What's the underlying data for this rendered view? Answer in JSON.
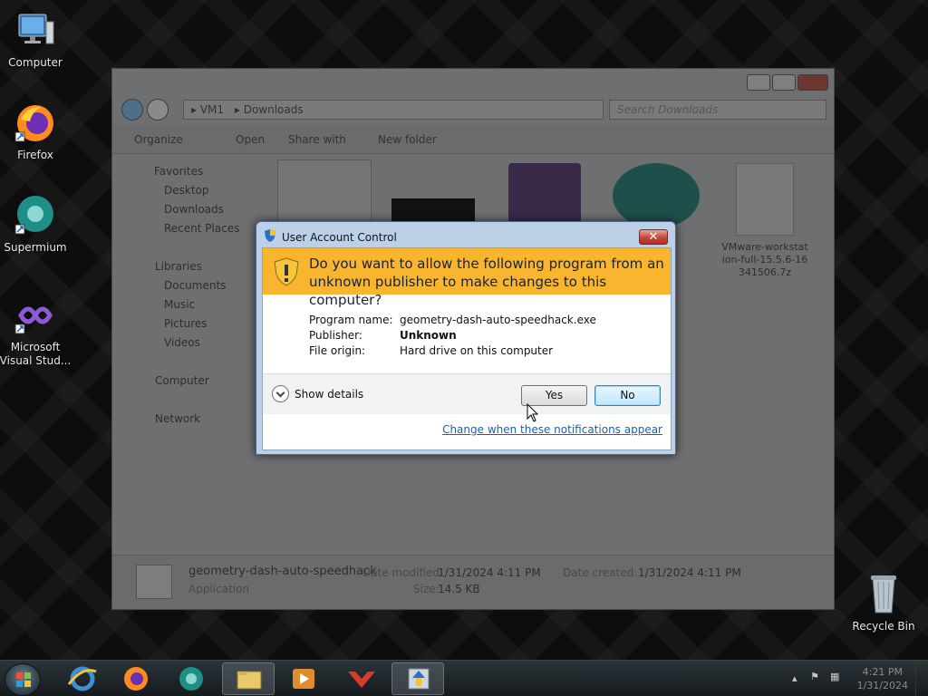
{
  "desktop": {
    "icons": [
      {
        "label": "Computer",
        "icon": "computer-icon"
      },
      {
        "label": "Firefox",
        "icon": "firefox-icon"
      },
      {
        "label": "Supermium",
        "icon": "supermium-icon"
      },
      {
        "label": "Microsoft Visual Stud...",
        "icon": "visual-studio-icon"
      },
      {
        "label": "Recycle Bin",
        "icon": "recycle-bin-icon"
      }
    ]
  },
  "explorer": {
    "breadcrumb": [
      "VM1",
      "Downloads"
    ],
    "search_placeholder": "Search Downloads",
    "toolbar": {
      "organize": "Organize",
      "open": "Open",
      "share_with": "Share with",
      "new_folder": "New folder"
    },
    "nav": {
      "favorites": "Favorites",
      "desktop": "Desktop",
      "downloads": "Downloads",
      "recent_places": "Recent Places",
      "libraries": "Libraries",
      "documents": "Documents",
      "music": "Music",
      "pictures": "Pictures",
      "videos": "Videos",
      "computer": "Computer",
      "network": "Network"
    },
    "files": [
      {
        "name": "VMware-workstation-full-15.5.6-16341506.7z",
        "display": [
          "VMware-workstat",
          "ion-full-15.5.6-16",
          "341506.7z"
        ]
      }
    ],
    "status": {
      "filename": "geometry-dash-auto-speedhack",
      "type": "Application",
      "date_modified_label": "Date modified:",
      "date_modified": "1/31/2024 4:11 PM",
      "date_created_label": "Date created:",
      "date_created": "1/31/2024 4:11 PM",
      "size_label": "Size:",
      "size": "14.5 KB"
    }
  },
  "uac": {
    "title": "User Account Control",
    "question": "Do you want to allow the following program from an unknown publisher to make changes to this computer?",
    "program_name_label": "Program name:",
    "program_name": "geometry-dash-auto-speedhack.exe",
    "publisher_label": "Publisher:",
    "publisher": "Unknown",
    "file_origin_label": "File origin:",
    "file_origin": "Hard drive on this computer",
    "show_details": "Show details",
    "yes": "Yes",
    "no": "No",
    "change_link": "Change when these notifications appear",
    "close": "✕"
  },
  "taskbar": {
    "time": "4:21 PM",
    "date": "1/31/2024"
  }
}
